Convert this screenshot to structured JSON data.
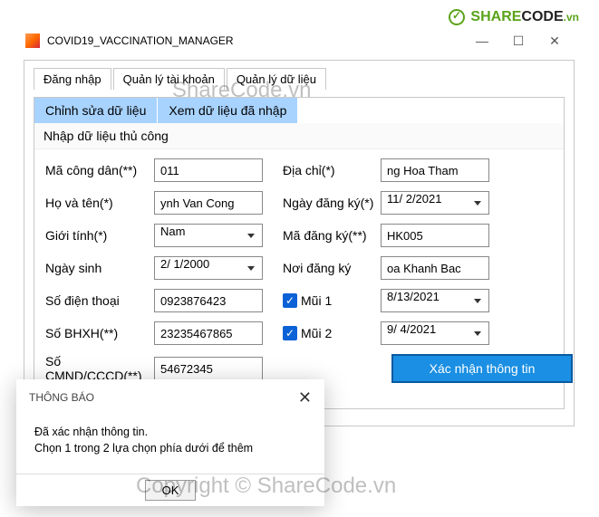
{
  "logo": {
    "share": "SHARE",
    "code": "CODE",
    "vn": ".vn"
  },
  "watermarks": {
    "top": "ShareCode.vn",
    "bottom": "Copyright © ShareCode.vn"
  },
  "titlebar": {
    "title": "COVID19_VACCINATION_MANAGER"
  },
  "main_tabs": [
    "Đăng nhập",
    "Quản lý tài khoản",
    "Quản lý dữ liệu"
  ],
  "sub_tabs": [
    "Chỉnh sửa dữ liệu",
    "Xem dữ liệu đã nhập"
  ],
  "section_label": "Nhập dữ liệu thủ công",
  "fields": {
    "ma_cong_dan": {
      "label": "Mã công dân(**)",
      "value": "011"
    },
    "ho_ten": {
      "label": "Họ và tên(*)",
      "value": "ynh Van Cong"
    },
    "gioi_tinh": {
      "label": "Giới tính(*)",
      "value": "Nam"
    },
    "ngay_sinh": {
      "label": "Ngày sinh",
      "value": "2/ 1/2000"
    },
    "sdt": {
      "label": "Số điện thoại",
      "value": "0923876423"
    },
    "bhxh": {
      "label": "Số BHXH(**)",
      "value": "23235467865"
    },
    "cmnd": {
      "label": "Số CMND/CCCD(**)",
      "value": "54672345"
    },
    "dia_chi": {
      "label": "Địa chỉ(*)",
      "value": "ng Hoa Tham"
    },
    "ngay_dk": {
      "label": "Ngày đăng ký(*)",
      "value": "11/ 2/2021"
    },
    "ma_dk": {
      "label": "Mã đăng ký(**)",
      "value": "HK005"
    },
    "noi_dk": {
      "label": "Nơi đăng ký",
      "value": "oa Khanh Bac"
    },
    "mui1": {
      "label": "Mũi 1",
      "checked": true,
      "date": "8/13/2021"
    },
    "mui2": {
      "label": "Mũi 2",
      "checked": true,
      "date": "9/ 4/2021"
    }
  },
  "confirm_button": "Xác nhận thông tin",
  "msgbox": {
    "title": "THÔNG BÁO",
    "line1": "Đã xác nhận thông tin.",
    "line2": "Chọn 1 trong 2 lựa chọn phía dưới để thêm",
    "ok": "OK"
  }
}
